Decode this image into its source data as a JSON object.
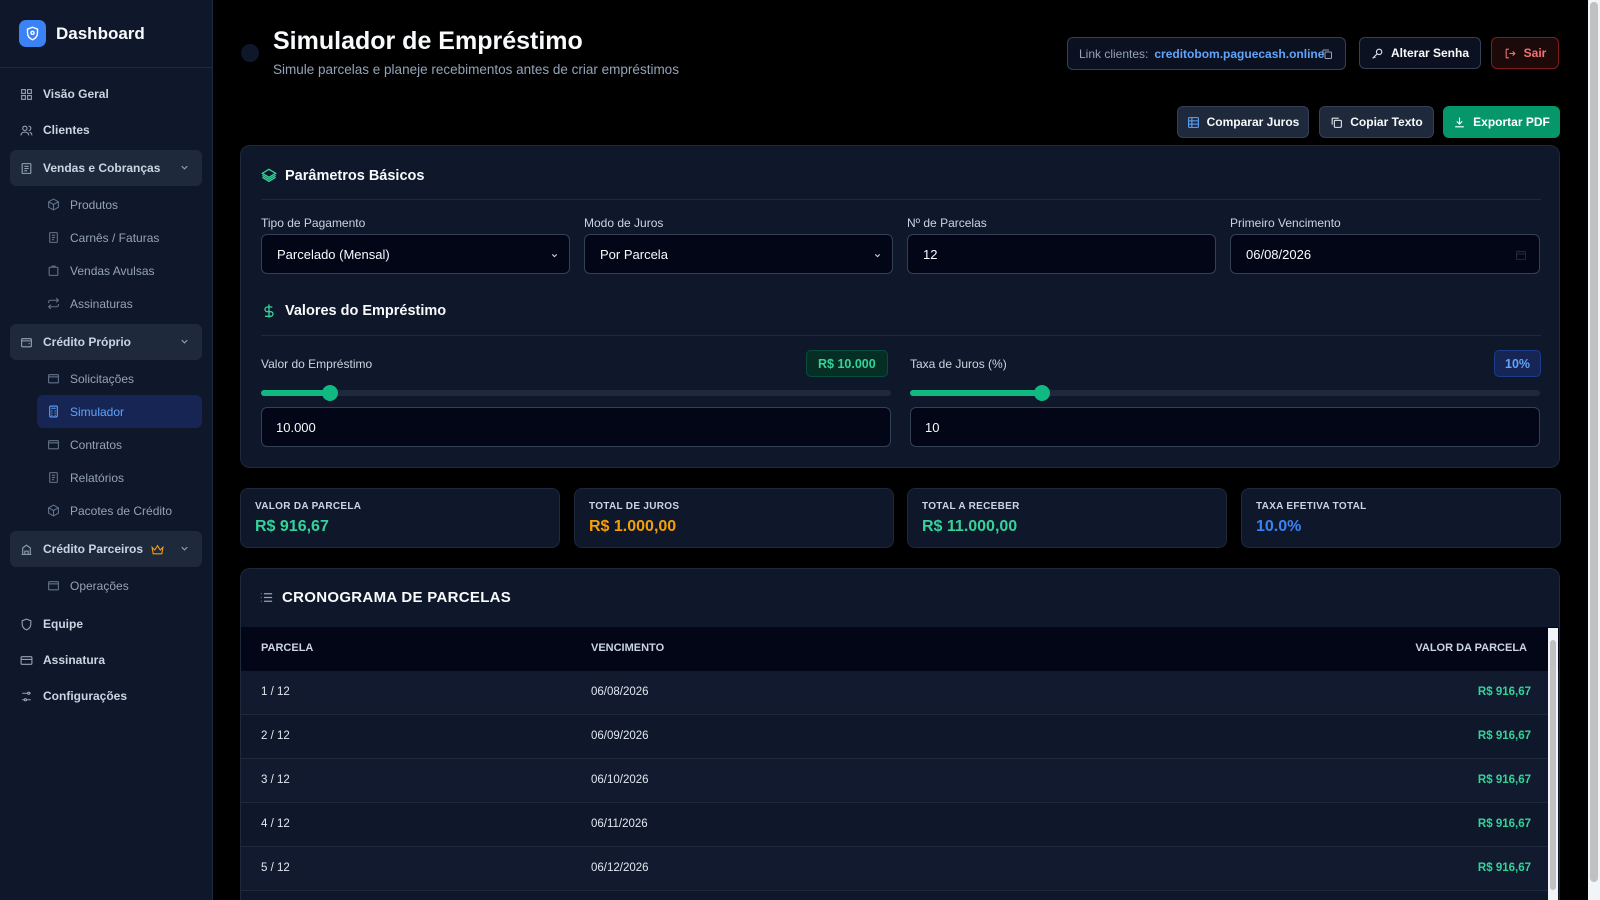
{
  "sidebar": {
    "brand": "Dashboard",
    "items": {
      "visao_geral": "Visão Geral",
      "clientes": "Clientes",
      "vendas_cobrancas": "Vendas e Cobranças",
      "produtos": "Produtos",
      "carnes_faturas": "Carnês / Faturas",
      "vendas_avulsas": "Vendas Avulsas",
      "assinaturas": "Assinaturas",
      "credito_proprio": "Crédito Próprio",
      "solicitacoes": "Solicitações",
      "simulador": "Simulador",
      "contratos": "Contratos",
      "relatorios": "Relatórios",
      "pacotes_credito": "Pacotes de Crédito",
      "credito_parceiros": "Crédito Parceiros",
      "operacoes": "Operações",
      "equipe": "Equipe",
      "assinatura": "Assinatura",
      "configuracoes": "Configurações"
    }
  },
  "header": {
    "title": "Simulador de Empréstimo",
    "subtitle": "Simule parcelas e planeje recebimentos antes de criar empréstimos",
    "link_label": "Link clientes:",
    "link_url": "creditobom.paguecash.online",
    "alterar_senha": "Alterar Senha",
    "sair": "Sair"
  },
  "toolbar": {
    "comparar_juros": "Comparar Juros",
    "copiar_texto": "Copiar Texto",
    "exportar_pdf": "Exportar PDF"
  },
  "params": {
    "section_title": "Parâmetros Básicos",
    "tipo_pagamento_label": "Tipo de Pagamento",
    "tipo_pagamento_value": "Parcelado (Mensal)",
    "modo_juros_label": "Modo de Juros",
    "modo_juros_value": "Por Parcela",
    "num_parcelas_label": "Nº de Parcelas",
    "num_parcelas_value": "12",
    "primeiro_venc_label": "Primeiro Vencimento",
    "primeiro_venc_value": "06/08/2026"
  },
  "valores": {
    "section_title": "Valores do Empréstimo",
    "valor_label": "Valor do Empréstimo",
    "valor_badge": "R$ 10.000",
    "valor_input": "10.000",
    "valor_slider_fraction": 0.11,
    "taxa_label": "Taxa de Juros (%)",
    "taxa_badge": "10%",
    "taxa_input": "10",
    "taxa_slider_fraction": 0.21
  },
  "stats": {
    "valor_parcela_label": "VALOR DA PARCELA",
    "valor_parcela_value": "R$ 916,67",
    "total_juros_label": "TOTAL DE JUROS",
    "total_juros_value": "R$ 1.000,00",
    "total_receber_label": "TOTAL A RECEBER",
    "total_receber_value": "R$ 11.000,00",
    "taxa_efetiva_label": "TAXA EFETIVA TOTAL",
    "taxa_efetiva_value": "10.0%"
  },
  "schedule": {
    "title": "CRONOGRAMA DE PARCELAS",
    "columns": [
      "PARCELA",
      "VENCIMENTO",
      "VALOR DA PARCELA"
    ],
    "rows": [
      {
        "parcela": "1 / 12",
        "vencimento": "06/08/2026",
        "valor": "R$ 916,67"
      },
      {
        "parcela": "2 / 12",
        "vencimento": "06/09/2026",
        "valor": "R$ 916,67"
      },
      {
        "parcela": "3 / 12",
        "vencimento": "06/10/2026",
        "valor": "R$ 916,67"
      },
      {
        "parcela": "4 / 12",
        "vencimento": "06/11/2026",
        "valor": "R$ 916,67"
      },
      {
        "parcela": "5 / 12",
        "vencimento": "06/12/2026",
        "valor": "R$ 916,67"
      }
    ]
  },
  "colors": {
    "accent_blue": "#3b82f6",
    "accent_green": "#10b981",
    "accent_orange": "#f59e0b",
    "danger": "#f87171"
  }
}
